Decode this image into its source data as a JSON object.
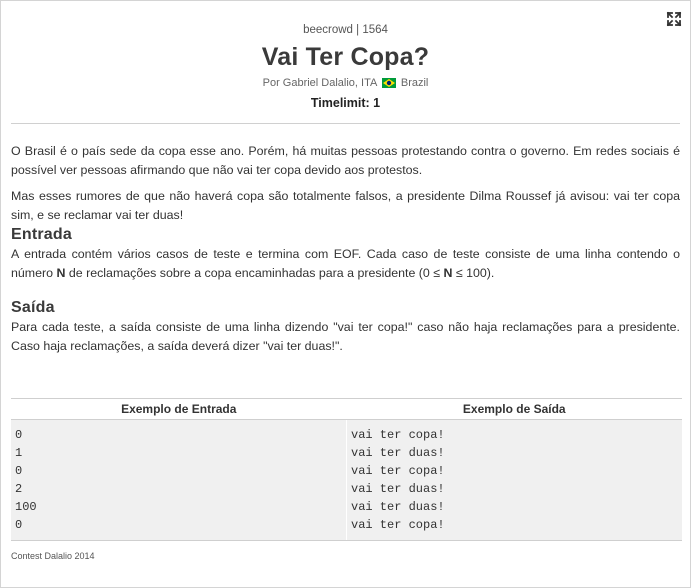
{
  "header": {
    "breadcrumb": "beecrowd | 1564",
    "title": "Vai Ter Copa?",
    "author": "Por Gabriel Dalalio, ITA",
    "country": "Brazil",
    "timelimit": "Timelimit: 1",
    "expand_icon": "expand-icon"
  },
  "description": {
    "p1": "O Brasil é o país sede da copa esse ano. Porém, há muitas pessoas protestando contra o governo. Em redes sociais é possível ver pessoas afirmando que não vai ter copa devido aos protestos.",
    "p2": "Mas esses rumores de que não haverá copa são totalmente falsos, a presidente Dilma Roussef já avisou: vai ter copa sim, e se reclamar vai ter duas!"
  },
  "input": {
    "heading": "Entrada",
    "text_before": "A entrada contém vários casos de teste e termina com EOF. Cada caso de teste consiste de uma linha contendo o número ",
    "var": "N",
    "text_middle": " de reclamações sobre a copa encaminhadas para a presidente (0 ≤ ",
    "var2": "N",
    "text_after": " ≤ 100)."
  },
  "output": {
    "heading": "Saída",
    "text": "Para cada teste, a saída consiste de uma linha dizendo \"vai ter copa!\" caso não haja reclamações para a presidente. Caso haja reclamações, a saída deverá dizer \"vai ter duas!\"."
  },
  "examples": {
    "input_header": "Exemplo de Entrada",
    "output_header": "Exemplo de Saída",
    "input_lines": [
      "0",
      "1",
      "0",
      "2",
      "100",
      "0"
    ],
    "output_lines": [
      "vai ter copa!",
      "vai ter duas!",
      "vai ter copa!",
      "vai ter duas!",
      "vai ter duas!",
      "vai ter copa!"
    ]
  },
  "footer": {
    "contest": "Contest Dalalio 2014"
  },
  "colors": {
    "flag_green": "#009b3a",
    "flag_yellow": "#fedf00",
    "flag_blue": "#002776"
  }
}
